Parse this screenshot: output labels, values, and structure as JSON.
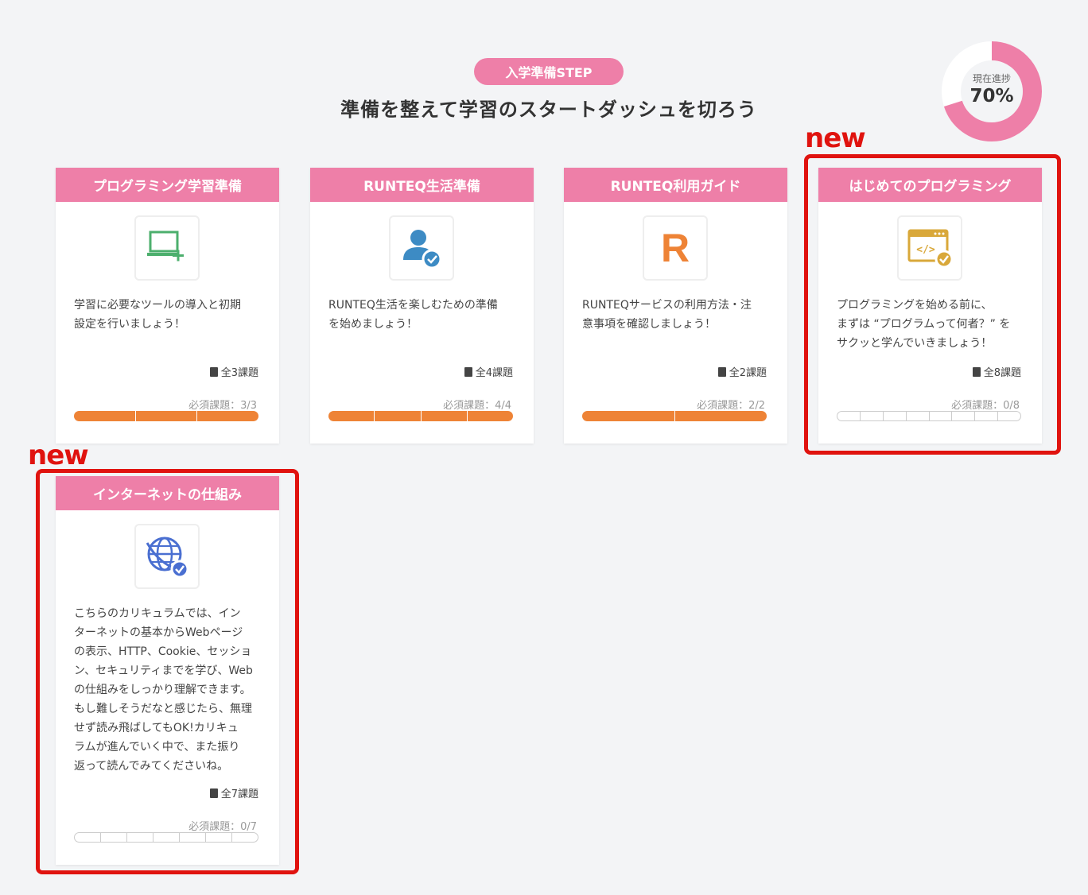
{
  "header": {
    "pill": "入学準備STEP",
    "title": "準備を整えて学習のスタートダッシュを切ろう"
  },
  "progress": {
    "label": "現在進捗",
    "value_text": "70%",
    "percent": 70,
    "color": "#ee7fa8",
    "track_color": "#ffffff"
  },
  "new_label": "new",
  "cards": [
    {
      "title": "プログラミング学習準備",
      "icon": "laptop-plus-icon",
      "desc_lines": [
        "学習に必要なツールの導入と初期",
        "設定を行いましょう！"
      ],
      "count": "全3課題",
      "required": "必須課題：3/3",
      "done": 3,
      "total": 3
    },
    {
      "title": "RUNTEQ生活準備",
      "icon": "user-check-icon",
      "desc_lines": [
        "RUNTEQ生活を楽しむための準備",
        "を始めましょう！"
      ],
      "count": "全4課題",
      "required": "必須課題：4/4",
      "done": 4,
      "total": 4
    },
    {
      "title": "RUNTEQ利用ガイド",
      "icon": "runteq-logo-icon",
      "icon_letter": "R",
      "desc_lines": [
        "RUNTEQサービスの利用方法・注",
        "意事項を確認しましょう！"
      ],
      "count": "全2課題",
      "required": "必須課題：2/2",
      "done": 2,
      "total": 2
    },
    {
      "title": "はじめてのプログラミング",
      "icon": "code-window-icon",
      "icon_text": "</>",
      "desc_lines": [
        "プログラミングを始める前に、",
        "まずは “プログラムって何者？” を",
        "サクッと学んでいきましょう！"
      ],
      "count": "全8課題",
      "required": "必須課題：0/8",
      "done": 0,
      "total": 8
    },
    {
      "title": "インターネットの仕組み",
      "icon": "globe-check-icon",
      "desc_lines": [
        "こちらのカリキュラムでは、イン",
        "ターネットの基本からWebページ",
        "の表示、HTTP、Cookie、セッショ",
        "ン、セキュリティまでを学び、Web",
        "の仕組みをしっかり理解できます。",
        "もし難しそうだなと感じたら、無理",
        "せず読み飛ばしてもOK!カリキュ",
        "ラムが進んでいく中で、また振り",
        "返って読んでみてくださいね。"
      ],
      "count": "全7課題",
      "required": "必須課題：0/7",
      "done": 0,
      "total": 7
    }
  ]
}
